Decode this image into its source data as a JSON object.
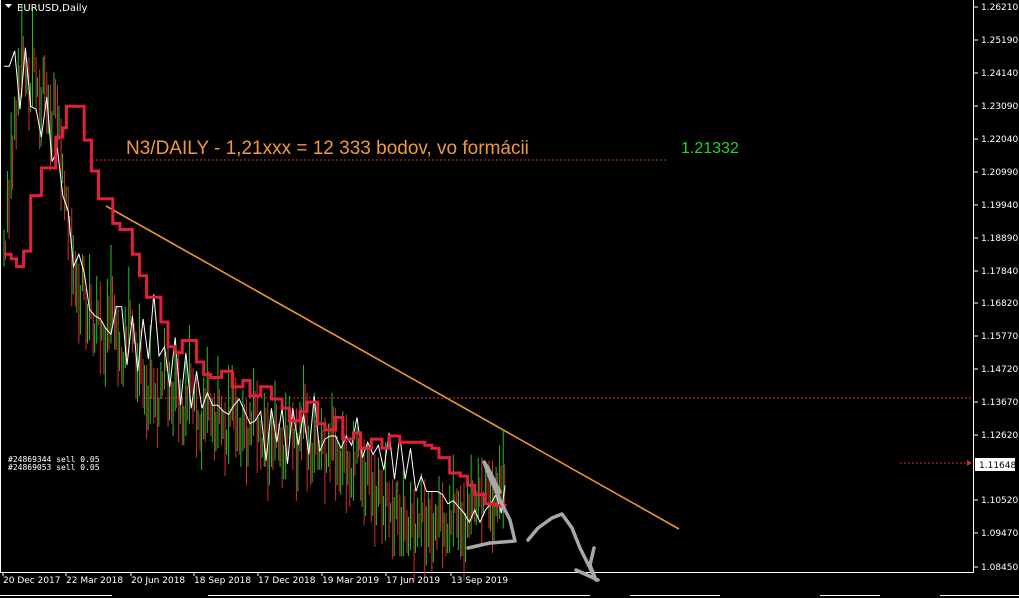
{
  "window": {
    "title": "EURUSD,Daily"
  },
  "chart_data": {
    "type": "line",
    "title": "EURUSD,Daily",
    "ylim": [
      1.0845,
      1.2662
    ],
    "y_ticks": [
      "1.26210",
      "1.25190",
      "1.24140",
      "1.23090",
      "1.22040",
      "1.20990",
      "1.19940",
      "1.18890",
      "1.17840",
      "1.16820",
      "1.15770",
      "1.14720",
      "1.13670",
      "1.12620",
      "1.11648",
      "1.10520",
      "1.09470",
      "1.08450"
    ],
    "x_ticks": [
      "20 Dec 2017",
      "22 Mar 2018",
      "20 Jun 2018",
      "18 Sep 2018",
      "17 Dec 2018",
      "19 Mar 2019",
      "17 Jun 2019",
      "13 Sep 2019"
    ],
    "current_price": "1.11648",
    "annotation": "N3/DAILY - 1,21xxx = 12 333 bodov, vo formácii",
    "target_label": "1.21332",
    "target_level": 1.21332,
    "support_level": 1.1375,
    "trendline": {
      "from": [
        "24 Jan 2018",
        1.198
      ],
      "to": [
        "25 Dec 2019",
        1.1015
      ]
    },
    "orders": [
      "#24869344 sell 0.05",
      "#24869053 sell 0.05"
    ],
    "series": [
      {
        "style": "step",
        "color": "#e0203a",
        "x": [
          0,
          4,
          7,
          11,
          15,
          21,
          29,
          33,
          35,
          41,
          45,
          49,
          53,
          61,
          65,
          72,
          76,
          80,
          88,
          92,
          96,
          100,
          104,
          108,
          112,
          116,
          122,
          128,
          134,
          138,
          144,
          150,
          156,
          160,
          166,
          170,
          176,
          180,
          186,
          190,
          196,
          200,
          206,
          212,
          216,
          222,
          230,
          236,
          240,
          244,
          250,
          256,
          260,
          264,
          270,
          276,
          281
        ],
        "values": [
          1.186,
          1.1845,
          1.182,
          1.187,
          1.205,
          1.214,
          1.224,
          1.227,
          1.234,
          1.234,
          1.223,
          1.213,
          1.204,
          1.196,
          1.194,
          1.186,
          1.179,
          1.172,
          1.164,
          1.156,
          1.154,
          1.158,
          1.158,
          1.151,
          1.147,
          1.146,
          1.148,
          1.143,
          1.145,
          1.14,
          1.143,
          1.139,
          1.136,
          1.132,
          1.135,
          1.138,
          1.131,
          1.129,
          1.133,
          1.126,
          1.128,
          1.123,
          1.126,
          1.123,
          1.127,
          1.125,
          1.125,
          1.124,
          1.123,
          1.12,
          1.115,
          1.114,
          1.111,
          1.108,
          1.105,
          1.1045,
          1.104
        ]
      },
      {
        "style": "line",
        "color": "#ffffff",
        "x": [
          0,
          3,
          6,
          9,
          12,
          15,
          18,
          21,
          24,
          27,
          30,
          33,
          36,
          39,
          42,
          45,
          48,
          51,
          54,
          57,
          60,
          63,
          66,
          69,
          72,
          75,
          78,
          81,
          84,
          87,
          90,
          93,
          96,
          99,
          102,
          105,
          108,
          111,
          114,
          117,
          120,
          123,
          126,
          129,
          132,
          135,
          138,
          141,
          144,
          147,
          150,
          153,
          156,
          159,
          162,
          165,
          168,
          171,
          174,
          177,
          180,
          183,
          186,
          189,
          192,
          195,
          198,
          201,
          204,
          207,
          210,
          213,
          216,
          219,
          222,
          225,
          228,
          231,
          234,
          237,
          240,
          243,
          246,
          249,
          252,
          255,
          258,
          261,
          264,
          267,
          270,
          273,
          276,
          279,
          281
        ],
        "values": [
          1.245,
          1.25,
          1.248,
          1.238,
          1.247,
          1.236,
          1.23,
          1.228,
          1.232,
          1.222,
          1.218,
          1.208,
          1.196,
          1.187,
          1.18,
          1.182,
          1.165,
          1.17,
          1.16,
          1.168,
          1.158,
          1.172,
          1.165,
          1.155,
          1.16,
          1.15,
          1.162,
          1.156,
          1.168,
          1.159,
          1.154,
          1.146,
          1.155,
          1.142,
          1.148,
          1.138,
          1.145,
          1.14,
          1.136,
          1.143,
          1.135,
          1.138,
          1.13,
          1.142,
          1.133,
          1.137,
          1.128,
          1.136,
          1.13,
          1.125,
          1.134,
          1.128,
          1.132,
          1.123,
          1.13,
          1.126,
          1.131,
          1.125,
          1.135,
          1.128,
          1.124,
          1.13,
          1.123,
          1.128,
          1.121,
          1.126,
          1.13,
          1.124,
          1.12,
          1.127,
          1.122,
          1.119,
          1.124,
          1.118,
          1.121,
          1.115,
          1.12,
          1.113,
          1.109,
          1.115,
          1.107,
          1.112,
          1.104,
          1.11,
          1.1,
          1.106,
          1.099,
          1.103,
          1.098,
          1.105,
          1.101,
          1.108,
          1.104,
          1.107,
          1.105
        ]
      },
      {
        "style": "candles",
        "x": [
          0,
          2,
          4,
          6,
          8,
          10,
          12,
          14,
          16,
          18,
          20,
          22,
          24,
          26,
          28,
          30,
          32,
          34,
          36,
          38,
          40,
          42,
          44,
          46,
          48,
          50,
          52,
          54,
          56,
          58,
          60,
          62,
          64,
          66,
          68,
          70,
          72,
          74,
          76,
          78,
          80,
          82,
          84,
          86,
          88,
          90,
          92,
          94,
          96,
          98,
          100,
          102,
          104,
          106,
          108,
          110,
          112,
          114,
          116,
          118,
          120,
          122,
          124,
          126,
          128,
          130,
          132,
          134,
          136,
          138,
          140,
          142,
          144,
          146,
          148,
          150,
          152,
          154,
          156,
          158,
          160,
          162,
          164,
          166,
          168,
          170,
          172,
          174,
          176,
          178,
          180,
          182,
          184,
          186,
          188,
          190,
          192,
          194,
          196,
          198,
          200,
          202,
          204,
          206,
          208,
          210,
          212,
          214,
          216,
          218,
          220,
          222,
          224,
          226,
          228,
          230,
          232,
          234,
          236,
          238,
          240,
          242,
          244,
          246,
          248,
          250,
          252,
          254,
          256,
          258,
          260,
          262,
          264,
          266,
          268,
          270,
          272,
          274,
          276,
          278,
          280
        ],
        "values": [
          1.188,
          1.203,
          1.218,
          1.23,
          1.242,
          1.252,
          1.245,
          1.238,
          1.25,
          1.241,
          1.233,
          1.244,
          1.235,
          1.227,
          1.238,
          1.23,
          1.215,
          1.205,
          1.196,
          1.185,
          1.178,
          1.17,
          1.18,
          1.165,
          1.172,
          1.16,
          1.168,
          1.162,
          1.155,
          1.166,
          1.173,
          1.164,
          1.156,
          1.15,
          1.159,
          1.168,
          1.161,
          1.15,
          1.155,
          1.144,
          1.138,
          1.147,
          1.14,
          1.136,
          1.145,
          1.152,
          1.144,
          1.138,
          1.146,
          1.14,
          1.132,
          1.139,
          1.147,
          1.14,
          1.133,
          1.128,
          1.136,
          1.142,
          1.134,
          1.13,
          1.138,
          1.132,
          1.126,
          1.134,
          1.141,
          1.133,
          1.127,
          1.132,
          1.125,
          1.131,
          1.138,
          1.13,
          1.124,
          1.129,
          1.122,
          1.126,
          1.132,
          1.125,
          1.12,
          1.127,
          1.133,
          1.127,
          1.121,
          1.13,
          1.138,
          1.125,
          1.12,
          1.128,
          1.122,
          1.126,
          1.119,
          1.124,
          1.13,
          1.121,
          1.117,
          1.123,
          1.118,
          1.113,
          1.119,
          1.124,
          1.116,
          1.112,
          1.118,
          1.11,
          1.106,
          1.112,
          1.104,
          1.109,
          1.103,
          1.1,
          1.106,
          1.098,
          1.102,
          1.096,
          1.101,
          1.095,
          1.099,
          1.103,
          1.097,
          1.1,
          1.096,
          1.099,
          1.104,
          1.098,
          1.095,
          1.1,
          1.106,
          1.102,
          1.099,
          1.096,
          1.103,
          1.108,
          1.105,
          1.11,
          1.106,
          1.112,
          1.108,
          1.104,
          1.109,
          1.112,
          1.113
        ]
      }
    ]
  }
}
